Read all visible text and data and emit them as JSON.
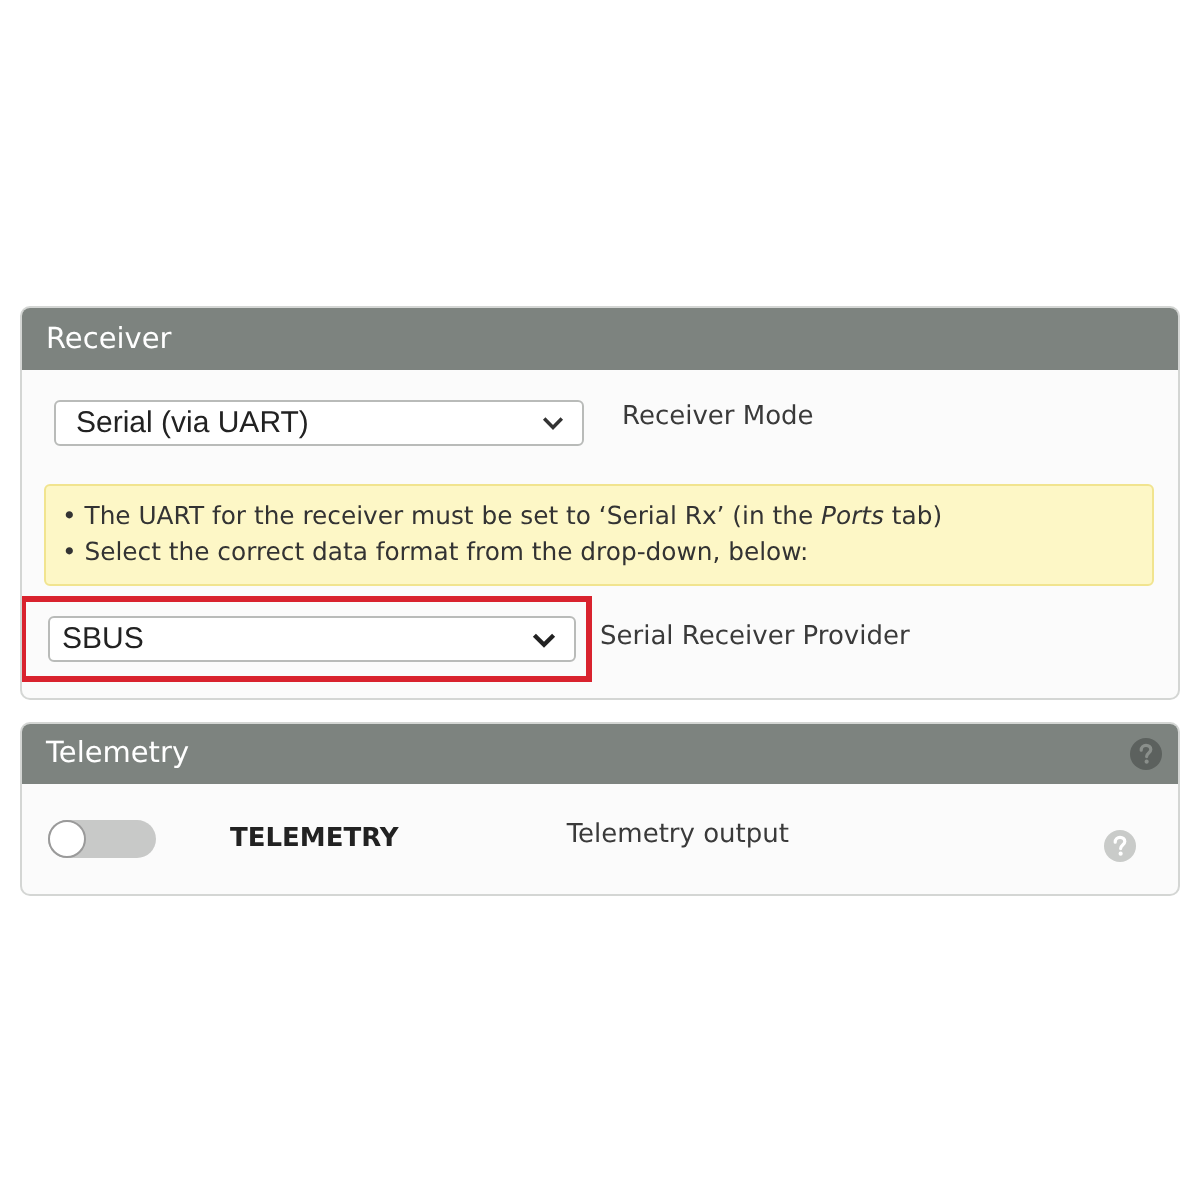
{
  "receiver": {
    "title": "Receiver",
    "mode_select": {
      "value": "Serial (via UART)",
      "label": "Receiver Mode"
    },
    "note": [
      "• The UART for the receiver must be set to ‘Serial Rx’ (in the *Ports* tab)",
      "• Select the correct data format from the drop-down, below:"
    ],
    "provider_select": {
      "value": "SBUS",
      "label": "Serial Receiver Provider",
      "highlighted": true
    }
  },
  "telemetry": {
    "title": "Telemetry",
    "toggle": {
      "on": false
    },
    "name": "TELEMETRY",
    "description": "Telemetry output"
  }
}
